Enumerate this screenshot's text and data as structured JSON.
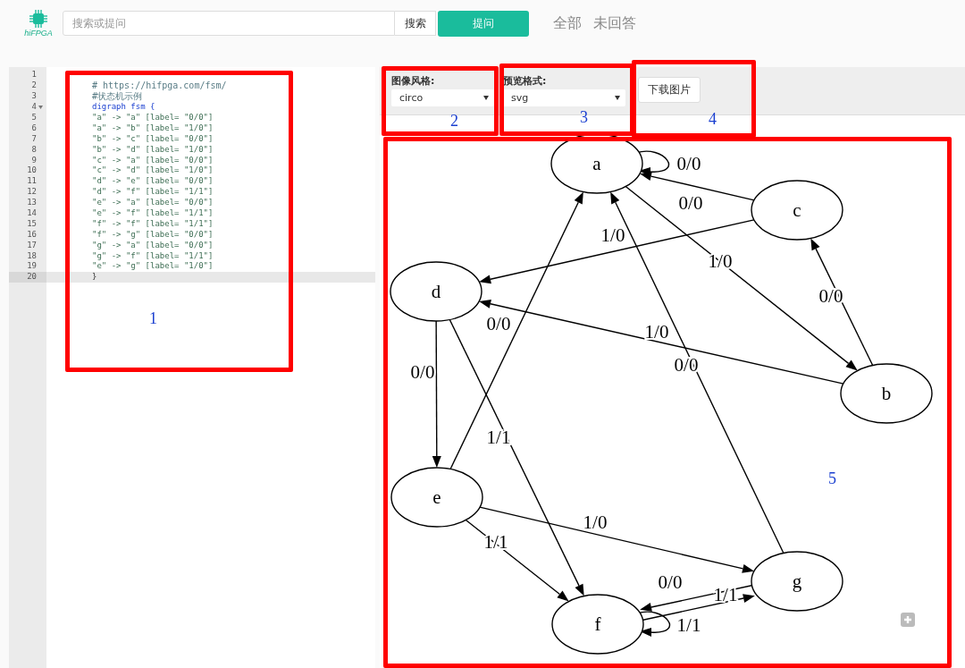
{
  "header": {
    "logo_text": "hiFPGA",
    "search": {
      "placeholder": "搜索或提问"
    },
    "search_button": "搜索",
    "ask_button": "提问",
    "nav": [
      {
        "label": "全部"
      },
      {
        "label": "未回答"
      }
    ]
  },
  "editor": {
    "lines": [
      {
        "number": "1",
        "foldable": false,
        "active": false
      },
      {
        "number": "2",
        "text": "# https://hifpga.com/fsm/",
        "kind": "comment",
        "foldable": false,
        "active": false
      },
      {
        "number": "3",
        "text": "#状态机示例",
        "kind": "comment",
        "foldable": false,
        "active": false
      },
      {
        "number": "4",
        "text": "digraph fsm {",
        "kind": "keyword",
        "foldable": true,
        "active": false
      },
      {
        "number": "5",
        "text": "\"a\" -> \"a\" [label= \"0/0\"]",
        "kind": "edge",
        "foldable": false,
        "active": false
      },
      {
        "number": "6",
        "text": "\"a\" -> \"b\" [label= \"1/0\"]",
        "kind": "edge",
        "foldable": false,
        "active": false
      },
      {
        "number": "7",
        "text": "\"b\" -> \"c\" [label= \"0/0\"]",
        "kind": "edge",
        "foldable": false,
        "active": false
      },
      {
        "number": "8",
        "text": "\"b\" -> \"d\" [label= \"1/0\"]",
        "kind": "edge",
        "foldable": false,
        "active": false
      },
      {
        "number": "9",
        "text": "\"c\" -> \"a\" [label= \"0/0\"]",
        "kind": "edge",
        "foldable": false,
        "active": false
      },
      {
        "number": "10",
        "text": "\"c\" -> \"d\" [label= \"1/0\"]",
        "kind": "edge",
        "foldable": false,
        "active": false
      },
      {
        "number": "11",
        "text": "\"d\" -> \"e\" [label= \"0/0\"]",
        "kind": "edge",
        "foldable": false,
        "active": false
      },
      {
        "number": "12",
        "text": "\"d\" -> \"f\" [label= \"1/1\"]",
        "kind": "edge",
        "foldable": false,
        "active": false
      },
      {
        "number": "13",
        "text": "\"e\" -> \"a\" [label= \"0/0\"]",
        "kind": "edge",
        "foldable": false,
        "active": false
      },
      {
        "number": "14",
        "text": "\"e\" -> \"f\" [label= \"1/1\"]",
        "kind": "edge",
        "foldable": false,
        "active": false
      },
      {
        "number": "15",
        "text": "\"f\" -> \"f\" [label= \"1/1\"]",
        "kind": "edge",
        "foldable": false,
        "active": false
      },
      {
        "number": "16",
        "text": "\"f\" -> \"g\" [label= \"0/0\"]",
        "kind": "edge",
        "foldable": false,
        "active": false
      },
      {
        "number": "17",
        "text": "\"g\" -> \"a\" [label= \"0/0\"]",
        "kind": "edge",
        "foldable": false,
        "active": false
      },
      {
        "number": "18",
        "text": "\"g\" -> \"f\" [label= \"1/1\"]",
        "kind": "edge",
        "foldable": false,
        "active": false
      },
      {
        "number": "19",
        "text": "\"e\" -> \"g\" [label= \"1/0\"]",
        "kind": "edge",
        "foldable": false,
        "active": false
      },
      {
        "number": "20",
        "text": "}",
        "kind": "code",
        "foldable": false,
        "active": true
      }
    ]
  },
  "toolbar": {
    "style_label": "图像风格:",
    "style_value": "circo",
    "format_label": "预览格式:",
    "format_value": "svg",
    "download_button": "下载图片"
  },
  "graph": {
    "nodes": [
      {
        "label": "a"
      },
      {
        "label": "b"
      },
      {
        "label": "c"
      },
      {
        "label": "d"
      },
      {
        "label": "e"
      },
      {
        "label": "f"
      },
      {
        "label": "g"
      }
    ],
    "edges": [
      {
        "label": "0/0"
      },
      {
        "label": "1/0"
      },
      {
        "label": "0/0"
      },
      {
        "label": "1/0"
      },
      {
        "label": "0/0"
      },
      {
        "label": "1/0"
      },
      {
        "label": "0/0"
      },
      {
        "label": "0/0"
      },
      {
        "label": "1/1"
      },
      {
        "label": "1/1"
      },
      {
        "label": "1/1"
      },
      {
        "label": "0/0"
      },
      {
        "label": "0/0"
      },
      {
        "label": "1/1"
      },
      {
        "label": "1/0"
      }
    ]
  },
  "annotations": [
    {
      "number": "1"
    },
    {
      "number": "2"
    },
    {
      "number": "3"
    },
    {
      "number": "4"
    },
    {
      "number": "5"
    }
  ]
}
